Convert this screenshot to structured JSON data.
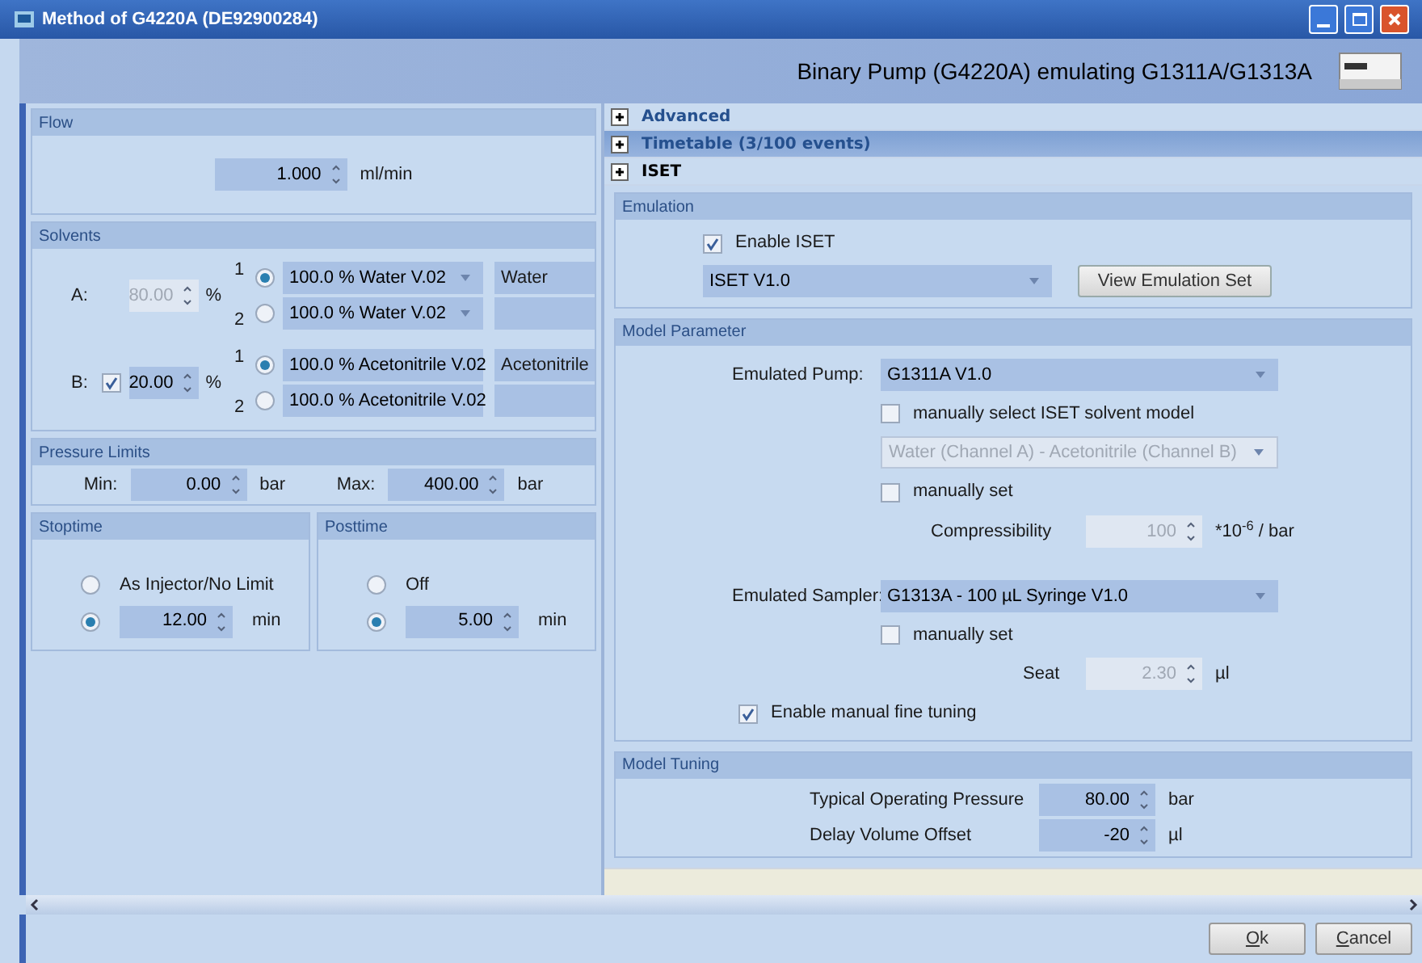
{
  "window": {
    "title": "Method of G4220A (DE92900284)"
  },
  "header": {
    "title": "Binary Pump (G4220A) emulating G1311A/G1313A"
  },
  "flow": {
    "title": "Flow",
    "value": "1.000",
    "unit": "ml/min"
  },
  "solvents": {
    "title": "Solvents",
    "percent_sign": "%",
    "rows": [
      {
        "kind": "auto",
        "label": "A:",
        "percent": "80.00",
        "disabled": true,
        "channels": [
          {
            "number": "1",
            "selected": true,
            "solvent": "100.0 % Water V.02",
            "name": "Water"
          },
          {
            "number": "2",
            "selected": false,
            "solvent": "100.0 % Water V.02"
          }
        ]
      },
      {
        "kind": "optional",
        "label": "B:",
        "checked": true,
        "percent": "20.00",
        "disabled": false,
        "channels": [
          {
            "number": "1",
            "selected": true,
            "solvent": "100.0 % Acetonitrile V.02",
            "name": "Acetonitrile"
          },
          {
            "number": "2",
            "selected": false,
            "solvent": "100.0 % Acetonitrile V.02"
          }
        ]
      }
    ]
  },
  "pressure_limits": {
    "title": "Pressure Limits",
    "fields": [
      {
        "label": "Min:",
        "value": "0.00",
        "unit": "bar"
      },
      {
        "label": "Max:",
        "value": "400.00",
        "unit": "bar"
      }
    ]
  },
  "time_groups": [
    {
      "title": "Stoptime",
      "options": [
        {
          "kind": "text",
          "label": "As Injector/No Limit",
          "selected": false
        },
        {
          "kind": "value",
          "value": "12.00",
          "unit": "min",
          "selected": true
        }
      ]
    },
    {
      "title": "Posttime",
      "options": [
        {
          "kind": "text",
          "label": "Off",
          "selected": false
        },
        {
          "kind": "value",
          "value": "5.00",
          "unit": "min",
          "selected": true
        }
      ]
    }
  ],
  "sections": [
    {
      "title": "Advanced",
      "selected": false
    },
    {
      "title": "Timetable (3/100 events)",
      "selected": true
    },
    {
      "title": "ISET",
      "selected": false
    }
  ],
  "emulation": {
    "title": "Emulation",
    "enable": {
      "label": "Enable ISET",
      "checked": true
    },
    "version": "ISET V1.0",
    "button": "View Emulation Set"
  },
  "model_parameter": {
    "title": "Model Parameter",
    "pump": {
      "label": "Emulated Pump:",
      "value": "G1311A V1.0"
    },
    "solvent_model_check": {
      "label": "manually select ISET solvent model",
      "checked": false
    },
    "solvent_model": {
      "value": "Water (Channel A) - Acetonitrile (Channel B)",
      "disabled": true
    },
    "pump_manual": {
      "label": "manually set",
      "checked": false
    },
    "compressibility": {
      "label": "Compressibility",
      "value": "100",
      "unit": "*10$^{-6}$ / bar",
      "disabled": true
    },
    "sampler": {
      "label": "Emulated Sampler:",
      "value": "G1313A - 100 µL Syringe V1.0"
    },
    "sampler_manual": {
      "label": "manually set",
      "checked": false
    },
    "seat": {
      "label": "Seat",
      "value": "2.30",
      "unit": "µl",
      "disabled": true
    },
    "fine_tuning": {
      "label": "Enable manual fine tuning",
      "checked": true
    }
  },
  "model_tuning": {
    "title": "Model Tuning",
    "fields": [
      {
        "label": "Typical Operating Pressure",
        "value": "80.00",
        "unit": "bar"
      },
      {
        "label": "Delay Volume Offset",
        "value": "-20",
        "unit": "µl"
      }
    ]
  },
  "buttons": [
    {
      "label": "Ok"
    },
    {
      "label": "Cancel"
    }
  ]
}
